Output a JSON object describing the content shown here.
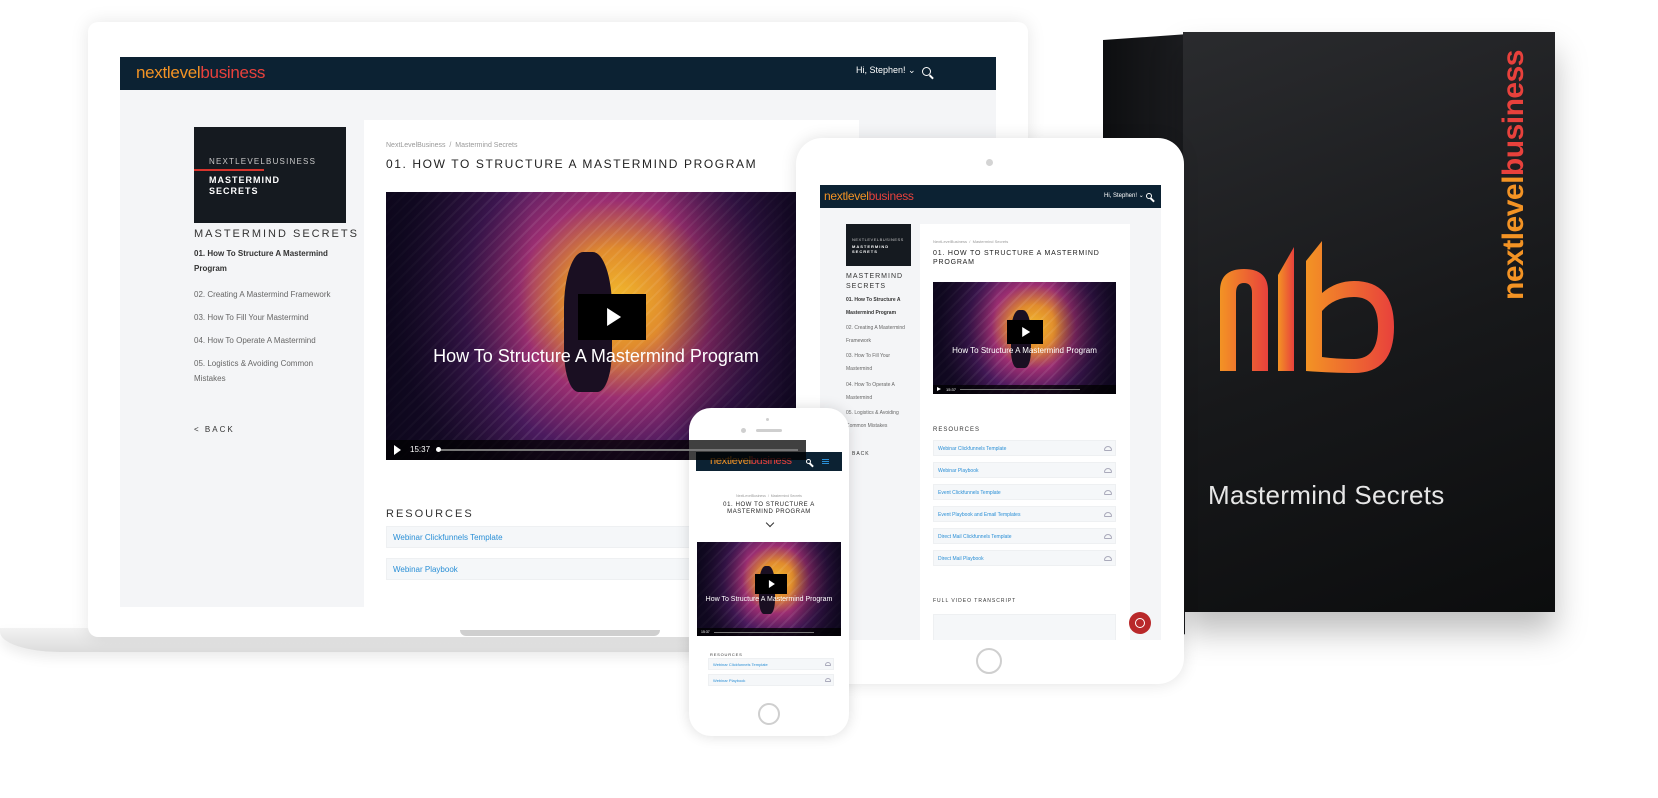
{
  "brand": {
    "logo_part1": "nextlevel",
    "logo_part2": "business",
    "accent_orange": "#f39324",
    "accent_red": "#e8413c",
    "header_bg": "#0c2233"
  },
  "header": {
    "greeting": "Hi, Stephen! ⌄",
    "search_icon": "search-icon"
  },
  "course": {
    "card_small": "NEXTLEVELBUSINESS",
    "card_big_line1": "MASTERMIND",
    "card_big_line2": "SECRETS",
    "sidebar_title": "MASTERMIND SECRETS",
    "lessons": [
      "01. How To Structure A Mastermind Program",
      "02. Creating A Mastermind Framework",
      "03. How To Fill Your Mastermind",
      "04. How To Operate A Mastermind",
      "05. Logistics & Avoiding Common Mistakes"
    ],
    "back": "< BACK",
    "back_tablet": "BACK"
  },
  "breadcrumb": {
    "home": "NextLevelBusiness",
    "sep": "/",
    "course": "Mastermind Secrets"
  },
  "lesson": {
    "title": "01. HOW TO STRUCTURE A MASTERMIND PROGRAM"
  },
  "video": {
    "caption": "How To Structure A Mastermind Program",
    "duration": "15:37"
  },
  "resources": {
    "title": "RESOURCES",
    "items": [
      "Webinar Clickfunnels Template",
      "Webinar Playbook",
      "Event Clickfunnels Template",
      "Event Playbook and Email Templates",
      "Direct Mail Clickfunnels Template",
      "Direct Mail Playbook"
    ]
  },
  "transcript": {
    "title": "FULL VIDEO TRANSCRIPT"
  },
  "product_box": {
    "spine_part1": "nextlevel",
    "spine_part2": "business",
    "title": "Mastermind Secrets"
  }
}
